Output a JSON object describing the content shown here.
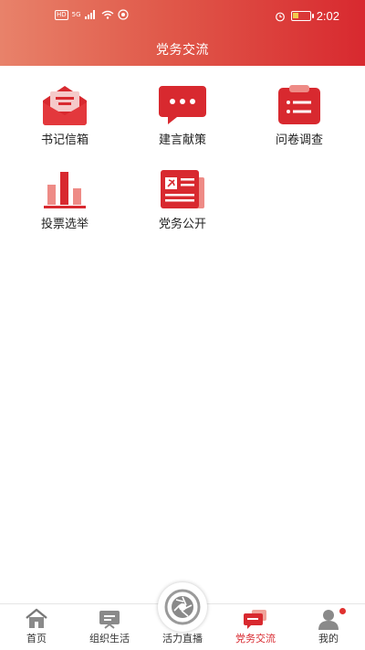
{
  "status_bar": {
    "hd_badge": "HD",
    "network": "5G",
    "time": "2:02"
  },
  "header": {
    "title": "党务交流"
  },
  "features": [
    {
      "label": "书记信箱",
      "icon": "envelope-icon"
    },
    {
      "label": "建言献策",
      "icon": "chat-bubble-icon"
    },
    {
      "label": "问卷调查",
      "icon": "clipboard-icon"
    },
    {
      "label": "投票选举",
      "icon": "bar-chart-icon"
    },
    {
      "label": "党务公开",
      "icon": "newspaper-icon"
    }
  ],
  "bottom_nav": {
    "items": [
      {
        "label": "首页",
        "icon": "home-icon"
      },
      {
        "label": "组织生活",
        "icon": "tv-icon"
      },
      {
        "label": "活力直播",
        "icon": "camera-aperture-icon"
      },
      {
        "label": "党务交流",
        "icon": "chat-icon"
      },
      {
        "label": "我的",
        "icon": "user-icon"
      }
    ],
    "active_index": 3
  },
  "colors": {
    "primary_red": "#d8292f",
    "header_gradient_start": "#e8826a",
    "header_gradient_end": "#d8292f"
  }
}
